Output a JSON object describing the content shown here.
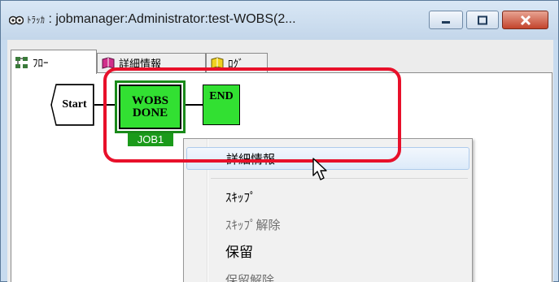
{
  "window": {
    "title_prefix": "ﾄﾗｯｶ",
    "title_main": " : jobmanager:Administrator:test-WOBS(2...",
    "icon": "tracker-icon",
    "colors": {
      "close_red": "#c3442c",
      "highlight_red": "#e8102a"
    }
  },
  "tabs": [
    {
      "label": "ﾌﾛｰ",
      "icon": "flow-icon",
      "active": true
    },
    {
      "label": "詳細情報",
      "icon": "details-book-icon",
      "active": false
    },
    {
      "label": "ﾛｸﾞ",
      "icon": "log-book-icon",
      "active": false
    }
  ],
  "flow": {
    "start_label": "Start",
    "job": {
      "line1": "WOBS",
      "line2": "DONE",
      "name": "JOB1",
      "color": "#32e032"
    },
    "end_label": "END"
  },
  "context_menu": {
    "items": [
      {
        "label": "詳細情報",
        "state": "hover"
      },
      {
        "label": "ｽｷｯﾌﾟ",
        "state": "normal"
      },
      {
        "label": "ｽｷｯﾌﾟ解除",
        "state": "disabled"
      },
      {
        "label": "保留",
        "state": "normal"
      },
      {
        "label": "保留解除",
        "state": "disabled"
      }
    ]
  }
}
